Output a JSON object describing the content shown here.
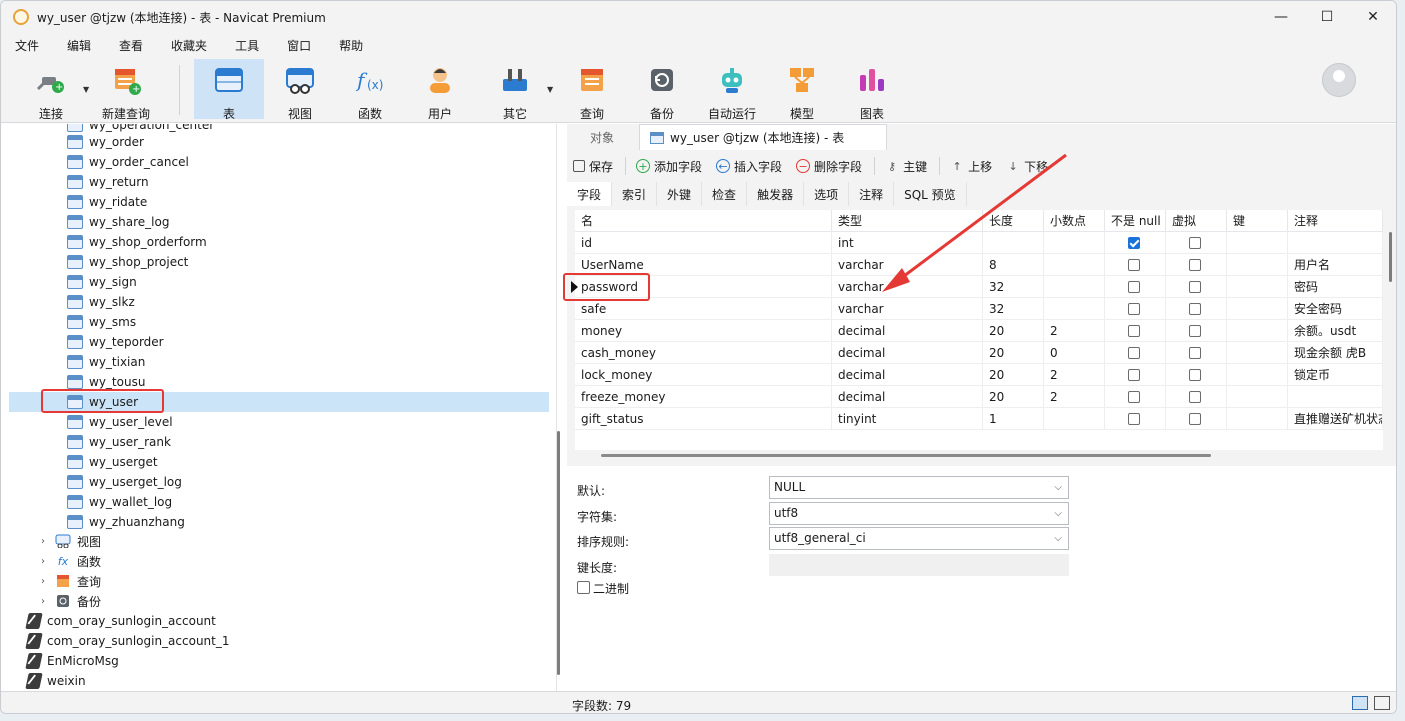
{
  "window": {
    "title": "wy_user @tjzw (本地连接) - 表 - Navicat Premium",
    "controls": [
      "—",
      "☐",
      "✕"
    ]
  },
  "menu": [
    "文件",
    "编辑",
    "查看",
    "收藏夹",
    "工具",
    "窗口",
    "帮助"
  ],
  "toolbar": {
    "items": [
      {
        "label": "连接",
        "icon": "plug-icon",
        "has_dropdown": true
      },
      {
        "label": "新建查询",
        "icon": "new-query-icon",
        "has_dropdown": false
      },
      {
        "label": "表",
        "icon": "table-icon",
        "active": true
      },
      {
        "label": "视图",
        "icon": "view-icon"
      },
      {
        "label": "函数",
        "icon": "function-icon"
      },
      {
        "label": "用户",
        "icon": "user-icon"
      },
      {
        "label": "其它",
        "icon": "tools-icon",
        "has_dropdown": true
      },
      {
        "label": "查询",
        "icon": "query-icon"
      },
      {
        "label": "备份",
        "icon": "backup-icon"
      },
      {
        "label": "自动运行",
        "icon": "robot-icon"
      },
      {
        "label": "模型",
        "icon": "model-icon"
      },
      {
        "label": "图表",
        "icon": "chart-icon"
      }
    ]
  },
  "tree": {
    "tables": [
      "wy_operation_center",
      "wy_order",
      "wy_order_cancel",
      "wy_return",
      "wy_ridate",
      "wy_share_log",
      "wy_shop_orderform",
      "wy_shop_project",
      "wy_sign",
      "wy_slkz",
      "wy_sms",
      "wy_teporder",
      "wy_tixian",
      "wy_tousu",
      "wy_user",
      "wy_user_level",
      "wy_user_rank",
      "wy_userget",
      "wy_userget_log",
      "wy_wallet_log",
      "wy_zhuanzhang"
    ],
    "selected": "wy_user",
    "groups": [
      {
        "label": "视图",
        "icon": "view-icon"
      },
      {
        "label": "函数",
        "icon": "function-icon"
      },
      {
        "label": "查询",
        "icon": "query-icon"
      },
      {
        "label": "备份",
        "icon": "backup-icon"
      }
    ],
    "databases": [
      "com_oray_sunlogin_account",
      "com_oray_sunlogin_account_1",
      "EnMicroMsg",
      "weixin"
    ]
  },
  "tabs": {
    "objects": "对象",
    "active": "wy_user @tjzw (本地连接) - 表"
  },
  "actions": {
    "save": "保存",
    "add_field": "添加字段",
    "insert_field": "插入字段",
    "delete_field": "删除字段",
    "primary_key": "主键",
    "move_up": "上移",
    "move_down": "下移"
  },
  "subtabs": [
    "字段",
    "索引",
    "外键",
    "检查",
    "触发器",
    "选项",
    "注释",
    "SQL 预览"
  ],
  "grid": {
    "headers": [
      "名",
      "类型",
      "长度",
      "小数点",
      "不是 null",
      "虚拟",
      "键",
      "注释"
    ],
    "rows": [
      {
        "name": "id",
        "type": "int",
        "length": "",
        "decimals": "",
        "not_null": true,
        "virtual": false,
        "key": "",
        "comment": ""
      },
      {
        "name": "UserName",
        "type": "varchar",
        "length": "8",
        "decimals": "",
        "not_null": false,
        "virtual": false,
        "key": "",
        "comment": "用户名"
      },
      {
        "name": "password",
        "type": "varchar",
        "length": "32",
        "decimals": "",
        "not_null": false,
        "virtual": false,
        "key": "",
        "comment": "密码",
        "current": true
      },
      {
        "name": "safe",
        "type": "varchar",
        "length": "32",
        "decimals": "",
        "not_null": false,
        "virtual": false,
        "key": "",
        "comment": "安全密码"
      },
      {
        "name": "money",
        "type": "decimal",
        "length": "20",
        "decimals": "2",
        "not_null": false,
        "virtual": false,
        "key": "",
        "comment": "余额。usdt"
      },
      {
        "name": "cash_money",
        "type": "decimal",
        "length": "20",
        "decimals": "0",
        "not_null": false,
        "virtual": false,
        "key": "",
        "comment": "现金余额 虎B"
      },
      {
        "name": "lock_money",
        "type": "decimal",
        "length": "20",
        "decimals": "2",
        "not_null": false,
        "virtual": false,
        "key": "",
        "comment": "锁定币"
      },
      {
        "name": "freeze_money",
        "type": "decimal",
        "length": "20",
        "decimals": "2",
        "not_null": false,
        "virtual": false,
        "key": "",
        "comment": ""
      },
      {
        "name": "gift_status",
        "type": "tinyint",
        "length": "1",
        "decimals": "",
        "not_null": false,
        "virtual": false,
        "key": "",
        "comment": "直推赠送矿机状态"
      }
    ]
  },
  "props": {
    "default_label": "默认:",
    "default_value": "NULL",
    "charset_label": "字符集:",
    "charset_value": "utf8",
    "collation_label": "排序规则:",
    "collation_value": "utf8_general_ci",
    "key_length_label": "键长度:",
    "binary_label": "二进制"
  },
  "status": {
    "field_count": "字段数: 79"
  },
  "colors": {
    "accent": "#1a73d9",
    "selection": "#cce4f7",
    "annotation": "#e53935"
  }
}
